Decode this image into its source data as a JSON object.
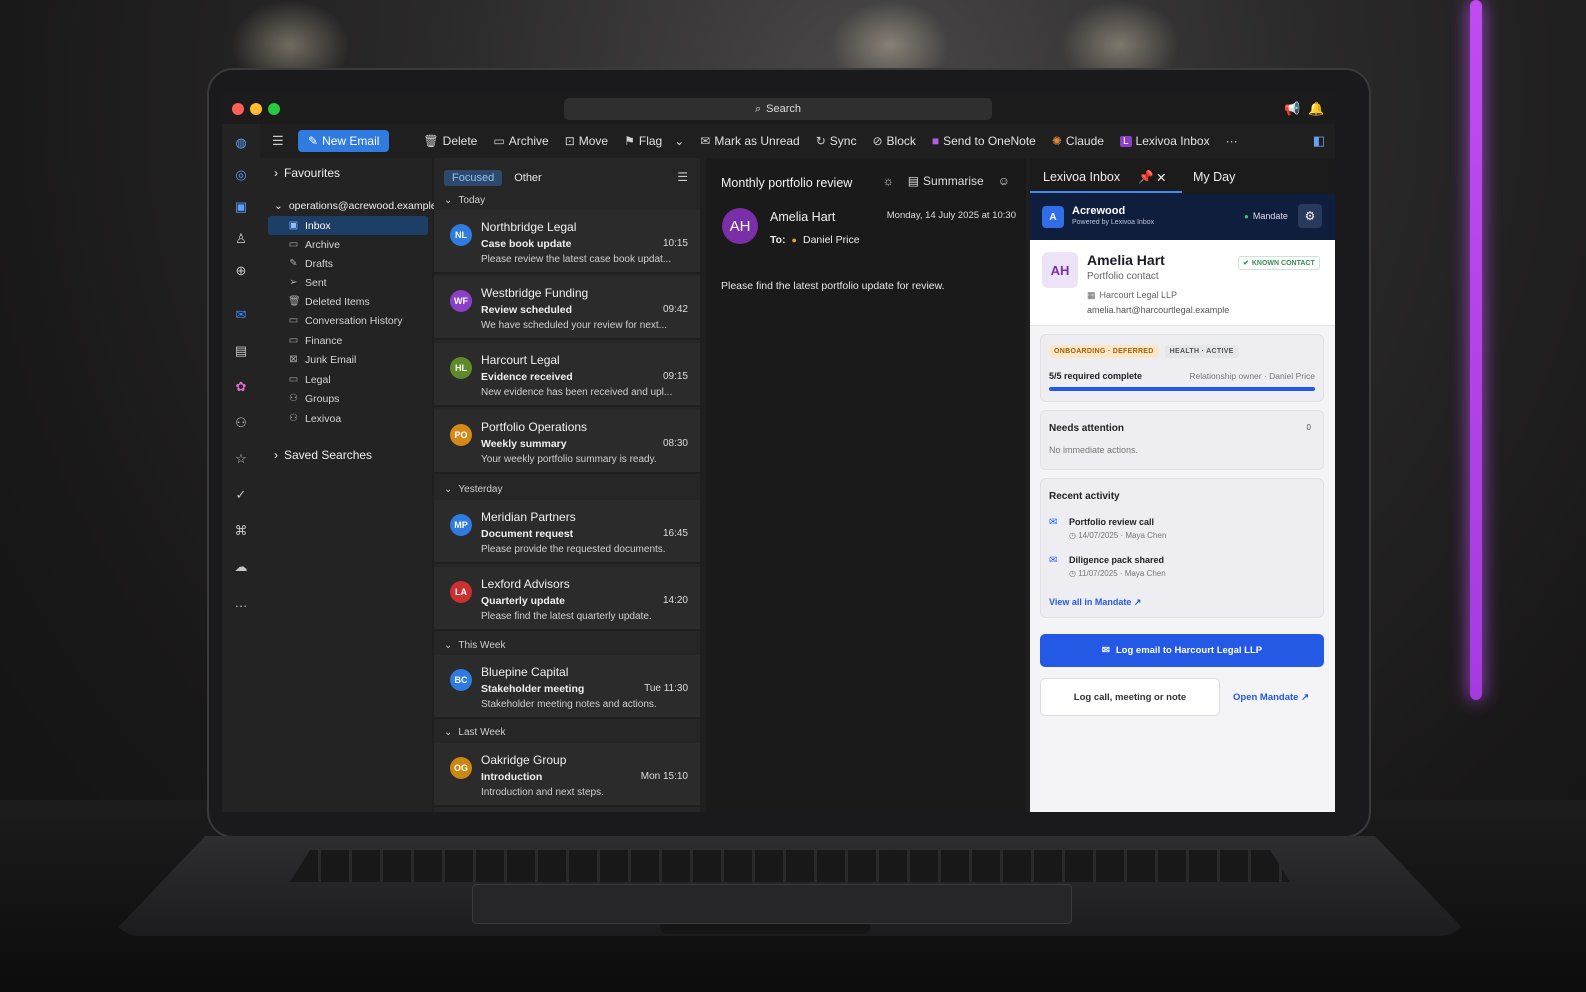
{
  "window": {
    "search_label": "Search"
  },
  "toolbar": {
    "new_email": "New Email",
    "delete": "Delete",
    "archive": "Archive",
    "move": "Move",
    "flag": "Flag",
    "mark_unread": "Mark as Unread",
    "sync": "Sync",
    "block": "Block",
    "onenote": "Send to OneNote",
    "claude": "Claude",
    "lexivoa": "Lexivoa Inbox",
    "more": "···"
  },
  "folders": {
    "favourites": "Favourites",
    "account": "operations@acrewood.example",
    "items": [
      "Inbox",
      "Archive",
      "Drafts",
      "Sent",
      "Deleted Items",
      "Conversation History",
      "Finance",
      "Junk Email",
      "Legal",
      "Groups",
      "Lexivoa"
    ],
    "saved_searches": "Saved Searches"
  },
  "list": {
    "tab_focused": "Focused",
    "tab_other": "Other",
    "groups": [
      "Today",
      "Yesterday",
      "This Week",
      "Last Week"
    ],
    "messages": [
      {
        "initials": "NL",
        "color": "#2f7be0",
        "sender": "Northbridge Legal",
        "subject": "Case book update",
        "time": "10:15",
        "preview": "Please review the latest case book updat..."
      },
      {
        "initials": "WF",
        "color": "#8a3fc7",
        "sender": "Westbridge Funding",
        "subject": "Review scheduled",
        "time": "09:42",
        "preview": "We have scheduled your review for next..."
      },
      {
        "initials": "HL",
        "color": "#5f8a2a",
        "sender": "Harcourt Legal",
        "subject": "Evidence received",
        "time": "09:15",
        "preview": "New evidence has been received and upl..."
      },
      {
        "initials": "PO",
        "color": "#d38a1a",
        "sender": "Portfolio Operations",
        "subject": "Weekly summary",
        "time": "08:30",
        "preview": "Your weekly portfolio summary is ready."
      },
      {
        "initials": "MP",
        "color": "#2f7be0",
        "sender": "Meridian Partners",
        "subject": "Document request",
        "time": "16:45",
        "preview": "Please provide the requested documents."
      },
      {
        "initials": "LA",
        "color": "#cc3030",
        "sender": "Lexford Advisors",
        "subject": "Quarterly update",
        "time": "14:20",
        "preview": "Please find the latest quarterly update."
      },
      {
        "initials": "BC",
        "color": "#2f7be0",
        "sender": "Bluepine Capital",
        "subject": "Stakeholder meeting",
        "time": "Tue 11:30",
        "preview": "Stakeholder meeting notes and actions."
      },
      {
        "initials": "OG",
        "color": "#c9880f",
        "sender": "Oakridge Group",
        "subject": "Introduction",
        "time": "Mon 15:10",
        "preview": "Introduction and next steps."
      }
    ]
  },
  "reading": {
    "subject": "Monthly portfolio review",
    "summarise": "Summarise",
    "avatar": "AH",
    "from": "Amelia Hart",
    "date": "Monday, 14 July 2025 at 10:30",
    "to_label": "To:",
    "to": "Daniel Price",
    "body": "Please find the latest portfolio update for review."
  },
  "addin": {
    "tab_active": "Lexivoa Inbox",
    "tab_other": "My Day",
    "org_initial": "A",
    "org_name": "Acrewood",
    "powered_by": "Powered by Lexivoa Inbox",
    "mandate_status": "Mandate",
    "contact_initials": "AH",
    "contact_name": "Amelia Hart",
    "contact_role": "Portfolio contact",
    "contact_badge": "KNOWN CONTACT",
    "contact_company": "Harcourt Legal LLP",
    "contact_email": "amelia.hart@harcourtlegal.example",
    "chip_onboarding": "ONBOARDING · DEFERRED",
    "chip_health": "HEALTH · ACTIVE",
    "required": "5/5 required complete",
    "owner": "Relationship owner · Daniel Price",
    "progress": 1.0,
    "needs_title": "Needs attention",
    "needs_count": "0",
    "needs_text": "No immediate actions.",
    "activity_title": "Recent activity",
    "activities": [
      {
        "title": "Portfolio review call",
        "meta": "14/07/2025 · Maya Chen"
      },
      {
        "title": "Diligence pack shared",
        "meta": "11/07/2025 · Maya Chen"
      }
    ],
    "view_all": "View all in Mandate ↗",
    "log_email": "Log email to Harcourt Legal LLP",
    "log_call": "Log call, meeting or note",
    "open_mandate": "Open Mandate ↗"
  }
}
